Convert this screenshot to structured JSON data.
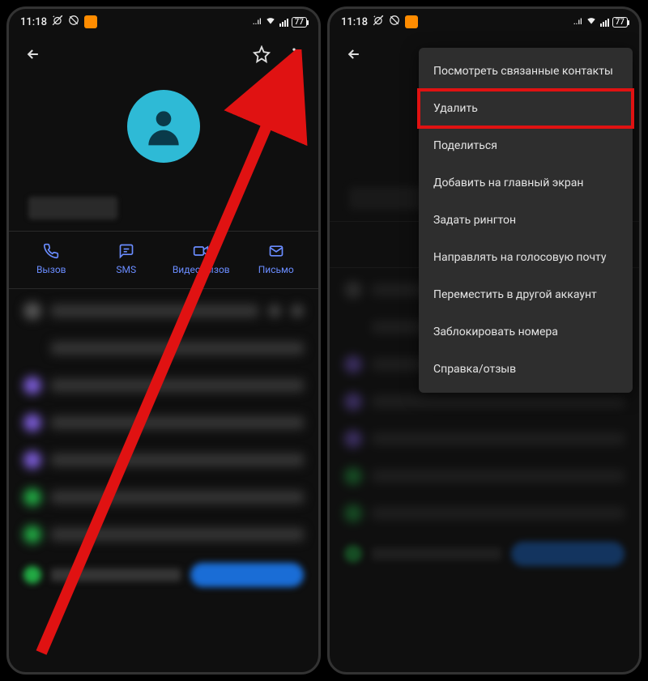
{
  "status": {
    "time": "11:18",
    "battery": "77"
  },
  "actions": {
    "call": "Вызов",
    "sms": "SMS",
    "video": "Видеовызов",
    "email": "Письмо"
  },
  "menu": {
    "view_linked": "Посмотреть связанные контакты",
    "delete": "Удалить",
    "share": "Поделиться",
    "add_home": "Добавить на главный экран",
    "set_ringtone": "Задать рингтон",
    "voicemail": "Направлять на голосовую почту",
    "move_account": "Переместить в другой аккаунт",
    "block": "Заблокировать номера",
    "help": "Справка/отзыв"
  },
  "list_colors": {
    "grey": "#555",
    "purple": "#7b5cd6",
    "green": "#22aa44"
  }
}
